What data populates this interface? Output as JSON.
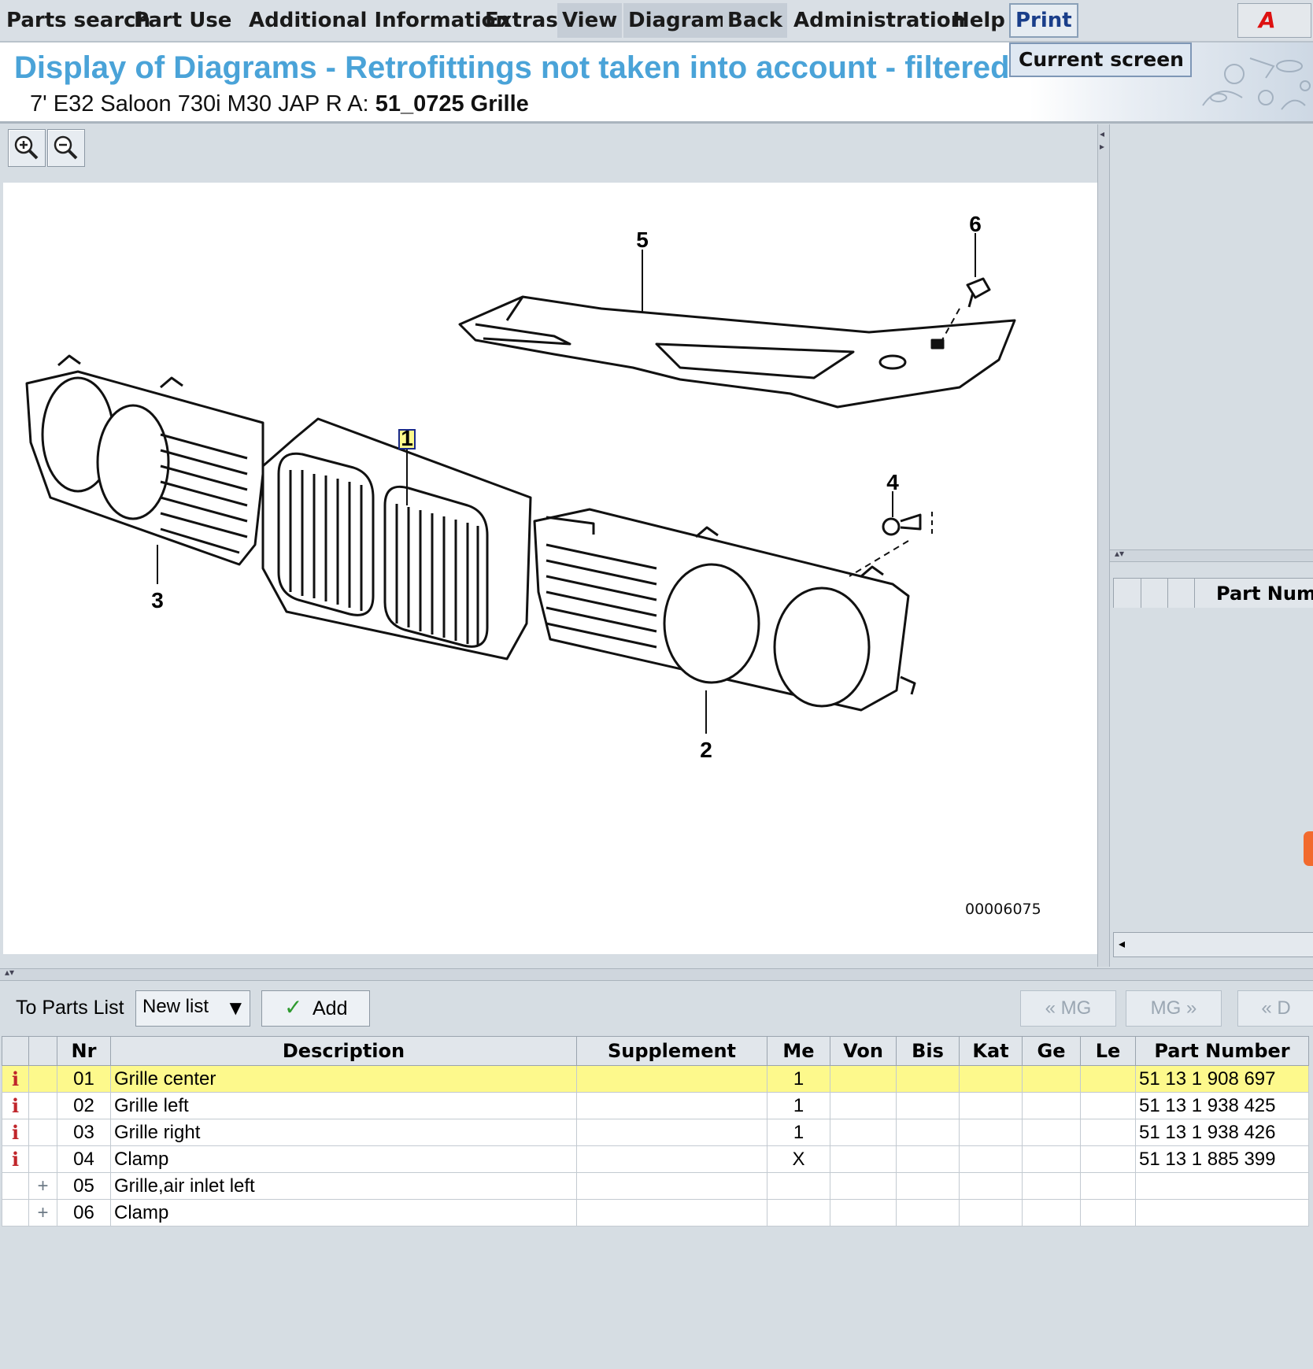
{
  "menu": {
    "items": [
      "Parts search",
      "Part Use",
      "Additional Information",
      "Extras",
      "View",
      "Diagram",
      "Back",
      "Administration",
      "Help",
      "Print"
    ],
    "print_dropdown": "Current screen"
  },
  "header": {
    "title": "Display of Diagrams - Retrofittings not taken into account - filtered",
    "vehicle": "7' E32 Saloon 730i M30 JAP  R A:",
    "group": "51_0725 Grille"
  },
  "diagram": {
    "callouts": [
      "1",
      "2",
      "3",
      "4",
      "5",
      "6"
    ],
    "id": "00006075"
  },
  "right_panel": {
    "column_label": "Part Numb"
  },
  "list_toolbar": {
    "label": "To Parts List",
    "select_value": "New list",
    "add_label": "Add",
    "nav": [
      "« MG",
      "MG »",
      "« D"
    ]
  },
  "table": {
    "headers": [
      "",
      "",
      "Nr",
      "Description",
      "Supplement",
      "Me",
      "Von",
      "Bis",
      "Kat",
      "Ge",
      "Le",
      "Part Number"
    ],
    "rows": [
      {
        "info": "i",
        "expand": "",
        "nr": "01",
        "desc": "Grille center",
        "supp": "",
        "me": "1",
        "von": "",
        "bis": "",
        "kat": "",
        "ge": "",
        "le": "",
        "pn": "51 13 1 908 697"
      },
      {
        "info": "i",
        "expand": "",
        "nr": "02",
        "desc": "Grille left",
        "supp": "",
        "me": "1",
        "von": "",
        "bis": "",
        "kat": "",
        "ge": "",
        "le": "",
        "pn": "51 13 1 938 425"
      },
      {
        "info": "i",
        "expand": "",
        "nr": "03",
        "desc": "Grille right",
        "supp": "",
        "me": "1",
        "von": "",
        "bis": "",
        "kat": "",
        "ge": "",
        "le": "",
        "pn": "51 13 1 938 426"
      },
      {
        "info": "i",
        "expand": "",
        "nr": "04",
        "desc": "Clamp",
        "supp": "",
        "me": "X",
        "von": "",
        "bis": "",
        "kat": "",
        "ge": "",
        "le": "",
        "pn": "51 13 1 885 399"
      },
      {
        "info": "",
        "expand": "+",
        "nr": "05",
        "desc": "Grille,air inlet left",
        "supp": "",
        "me": "",
        "von": "",
        "bis": "",
        "kat": "",
        "ge": "",
        "le": "",
        "pn": ""
      },
      {
        "info": "",
        "expand": "+",
        "nr": "06",
        "desc": "Clamp",
        "supp": "",
        "me": "",
        "von": "",
        "bis": "",
        "kat": "",
        "ge": "",
        "le": "",
        "pn": ""
      }
    ]
  },
  "colors": {
    "title": "#4aa3d8",
    "selected_row": "#fdf98c",
    "info_icon": "#c0262b",
    "add_check": "#2e9a2e",
    "background": "#d6dde3"
  },
  "icons": [
    "zoom-in-icon",
    "zoom-out-icon",
    "brand-logo-icon",
    "info-icon",
    "expand-icon",
    "check-icon",
    "dropdown-caret-icon"
  ]
}
